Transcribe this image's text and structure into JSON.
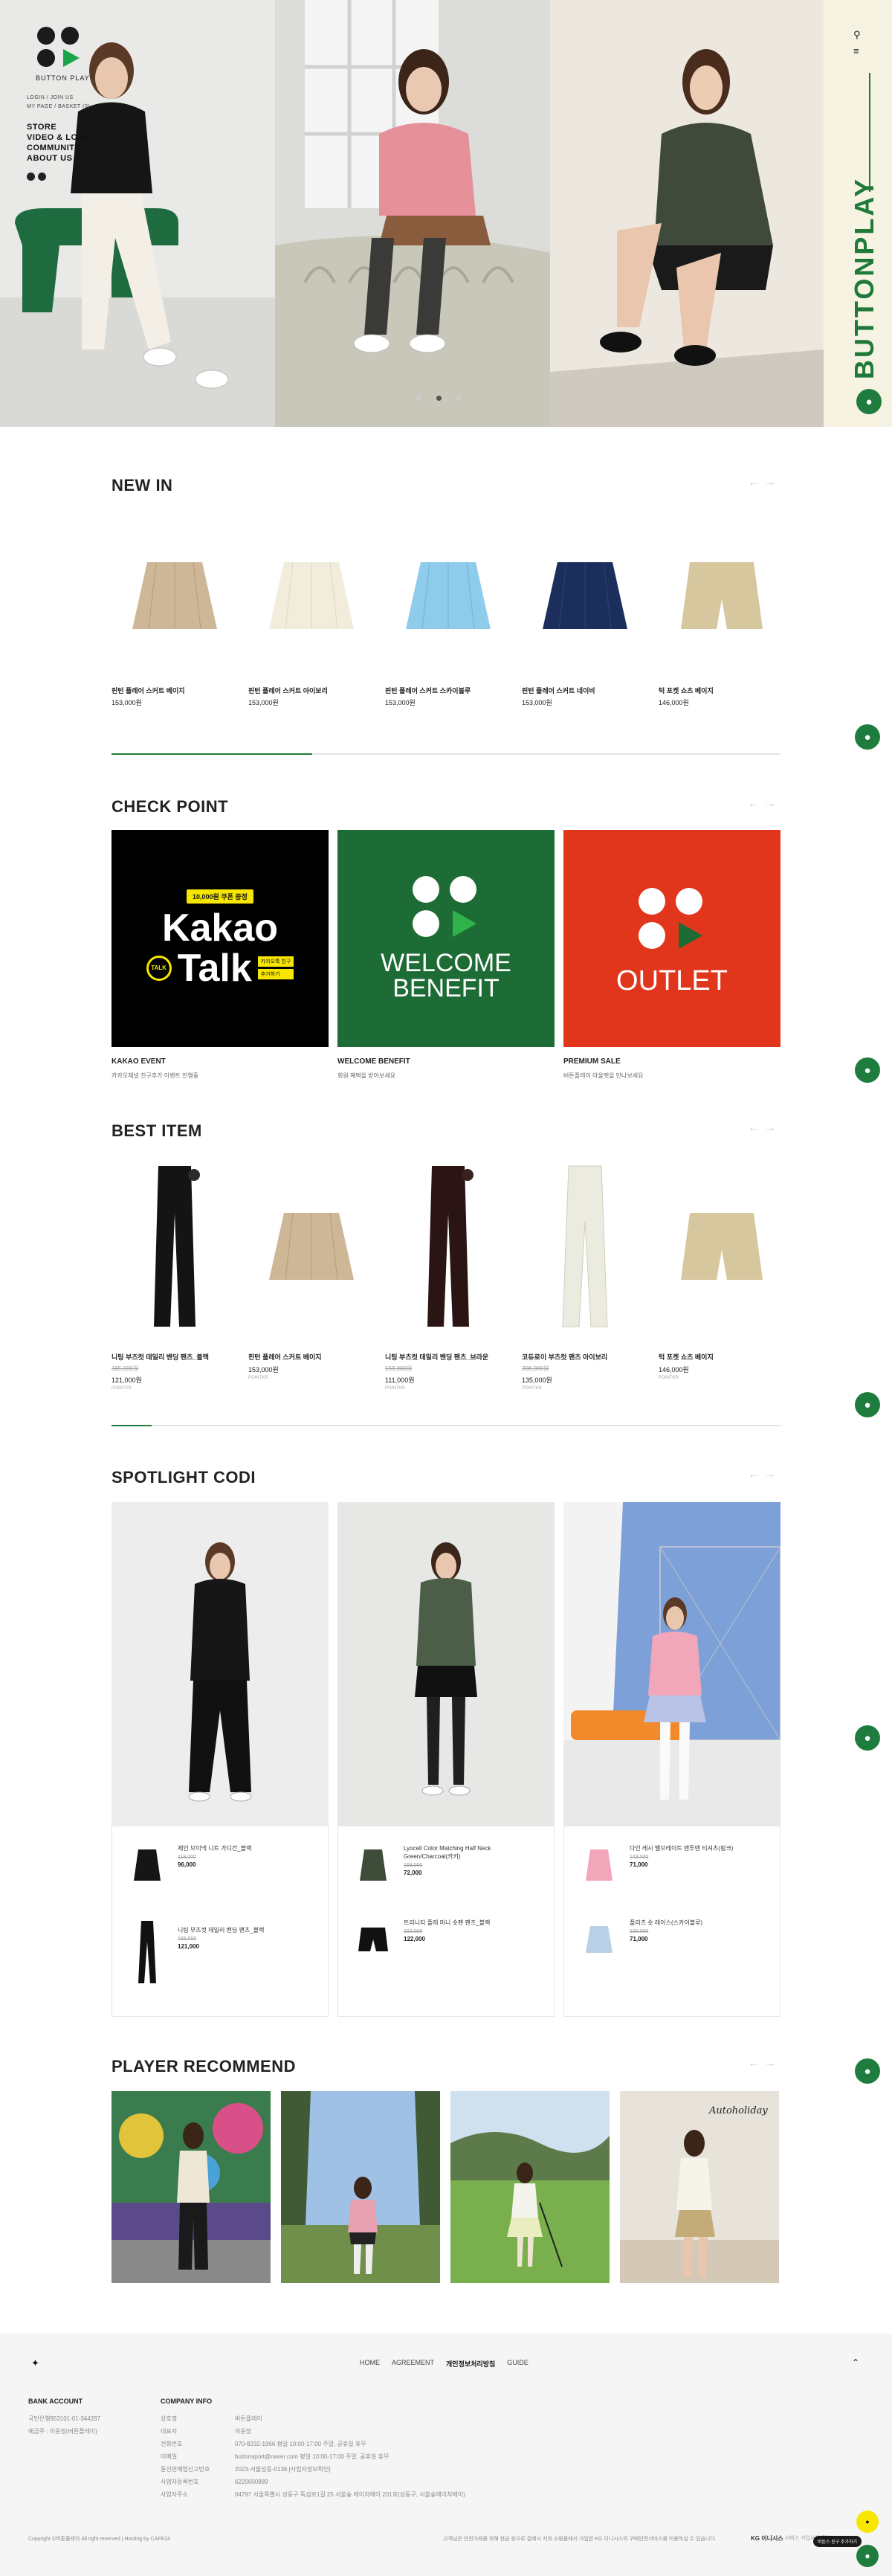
{
  "brand": {
    "name": "BUTTON PLAY",
    "rail_text": "BUTTONPLAY"
  },
  "nav": {
    "top_links": [
      "LOGIN / JOIN US",
      "MY PAGE / BASKET (0)"
    ],
    "menu": [
      "STORE",
      "VIDEO & LOOK",
      "COMMUNITY",
      "ABOUT US"
    ]
  },
  "icons": {
    "search": "search-icon",
    "menu": "hamburger-icon",
    "chat": "chat-icon",
    "up": "arrow-up-icon"
  },
  "colors": {
    "brand_green": "#1f7a3a",
    "kakao_yellow": "#f7e600",
    "welcome_green": "#1d6b35",
    "outlet_red": "#e2361c",
    "rail_bg": "#f7f3e3"
  },
  "new_in": {
    "title": "NEW IN",
    "products": [
      {
        "name": "핀턴 플레어 스커트 베이지",
        "price": "153,000원"
      },
      {
        "name": "핀턴 플레어 스커트 아이보리",
        "price": "153,000원"
      },
      {
        "name": "핀턴 플레어 스커트 스카이블루",
        "price": "153,000원"
      },
      {
        "name": "핀턴 플레어 스커트 네이비",
        "price": "153,000원"
      },
      {
        "name": "턱 포켓 쇼츠 베이지",
        "price": "146,000원"
      }
    ],
    "progress": 0.3
  },
  "check_point": {
    "title": "CHECK POINT",
    "cards": [
      {
        "title": "KAKAO EVENT",
        "desc": "카카오채널 친구추가 이벤트 진행중",
        "badge": "10,000원 쿠폰 증정",
        "big1": "Kakao",
        "big2": "Talk",
        "talk": "TALK",
        "tag1": "카카오톡 친구",
        "tag2": "추가하기"
      },
      {
        "title": "WELCOME BENEFIT",
        "desc": "회원 혜택을 받아보세요",
        "line1": "WELCOME",
        "line2": "BENEFIT"
      },
      {
        "title": "PREMIUM SALE",
        "desc": "버튼플레이 아울렛을 만나보세요",
        "line1": "OUTLET"
      }
    ]
  },
  "best_item": {
    "title": "BEST ITEM",
    "products": [
      {
        "name": "니팅 부츠컷 데일리 밴딩 팬츠_블랙",
        "old": "165,000원",
        "price": "121,000원",
        "sub": "POINTKR"
      },
      {
        "name": "핀턴 플레어 스커트 베이지",
        "old": "",
        "price": "153,000원",
        "sub": "POINTKR"
      },
      {
        "name": "니팅 부츠컷 데일리 밴딩 팬츠_브라운",
        "old": "153,000원",
        "price": "111,000원",
        "sub": "POINTKR"
      },
      {
        "name": "코듀로이 부츠컷 팬츠 아이보리",
        "old": "208,000원",
        "price": "135,000원",
        "sub": "POINTKR"
      },
      {
        "name": "턱 포켓 쇼츠 베이지",
        "old": "",
        "price": "146,000원",
        "sub": "POINTKR"
      }
    ],
    "progress": 0.06
  },
  "spotlight": {
    "title": "SPOTLIGHT CODI",
    "looks": [
      {
        "items": [
          {
            "name": "제인 브이넥 니트 가디건_블랙",
            "old": "119,000",
            "price": "96,000"
          },
          {
            "name": "니팅 부츠컷 데일리 밴딩 팬츠_블랙",
            "old": "165,000",
            "price": "121,000"
          }
        ]
      },
      {
        "items": [
          {
            "name": "Lyocell Color Matching Half Neck Green/Charcoal(카키)",
            "old": "159,000",
            "price": "72,000"
          },
          {
            "name": "트리니티 플레 미니 숏팬 팬츠_블랙",
            "old": "152,000",
            "price": "122,000"
          }
        ]
      },
      {
        "items": [
          {
            "name": "다인 레시 밸브레이트 맨투맨 티셔츠(핑크)",
            "old": "143,000",
            "price": "71,000"
          },
          {
            "name": "플리츠 숏 레이스(스카이블루)",
            "old": "100,000",
            "price": "71,000"
          }
        ]
      }
    ]
  },
  "player_recommend": {
    "title": "PLAYER RECOMMEND",
    "photo_text": "Autoholiday"
  },
  "footer": {
    "links": [
      {
        "label": "HOME",
        "bold": false
      },
      {
        "label": "AGREEMENT",
        "bold": false
      },
      {
        "label": "개인정보처리방침",
        "bold": true
      },
      {
        "label": "GUIDE",
        "bold": false
      }
    ],
    "bank_title": "BANK ACCOUNT",
    "bank_lines": [
      "국민은행953101-01-344287",
      "예금주 : 이윤정(버튼플레이)"
    ],
    "company_title": "COMPANY INFO",
    "company_keys": [
      "상호명",
      "대표자",
      "전화번호",
      "이메일",
      "통신판매업신고번호",
      "사업자등록번호",
      "사업자주소"
    ],
    "company_vals": [
      "버튼플레이",
      "이윤정",
      "070-8232-1966    평일 10:00-17:00 주말, 공휴일 휴무",
      "buttonsport@naver.com    평일 10:00-17:00 주말, 공휴일 휴무",
      "2023-서울성동-0136 [사업자정보확인]",
      "6220600889",
      "04797 서울특별시 성동구 뚝섬로1길 25 서울숲 에이치에이 201호(성동구, 서울숲에이치에이)"
    ],
    "copyright": "Copyright ©버튼플레이 All right reserved | Hosting by CAFE24",
    "escrow": "고객님은 안전거래를 위해 현금 등으로 결제시 저희 쇼핑몰에서 가입한 KG 이니시스의 구매안전서비스를 이용하실 수 있습니다.",
    "escrow_badge": "KG 이니시스",
    "escrow_check": "서비스 가입사실 확인",
    "corner_badge": "버튼스 친구 추가하기"
  }
}
